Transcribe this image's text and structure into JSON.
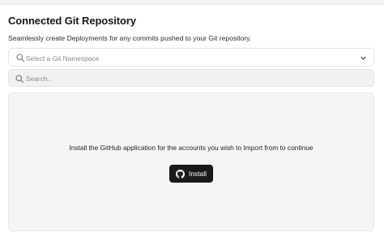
{
  "header": {
    "title": "Connected Git Repository",
    "subtitle": "Seamlessly create Deployments for any commits pushed to your Git repository."
  },
  "namespace_select": {
    "placeholder": "Select a Git Namespace",
    "icon": "search-icon",
    "chevron": "chevron-down-icon"
  },
  "search": {
    "placeholder": "Search...",
    "value": "",
    "icon": "search-icon"
  },
  "install_panel": {
    "message": "Install the GitHub application for the accounts you wish to Import from to continue",
    "button_label": "Install",
    "button_icon": "github-icon"
  },
  "colors": {
    "button_bg": "#1a1a1a",
    "panel_bg": "#f5f5f5",
    "search_bg": "#f1f1f1"
  }
}
